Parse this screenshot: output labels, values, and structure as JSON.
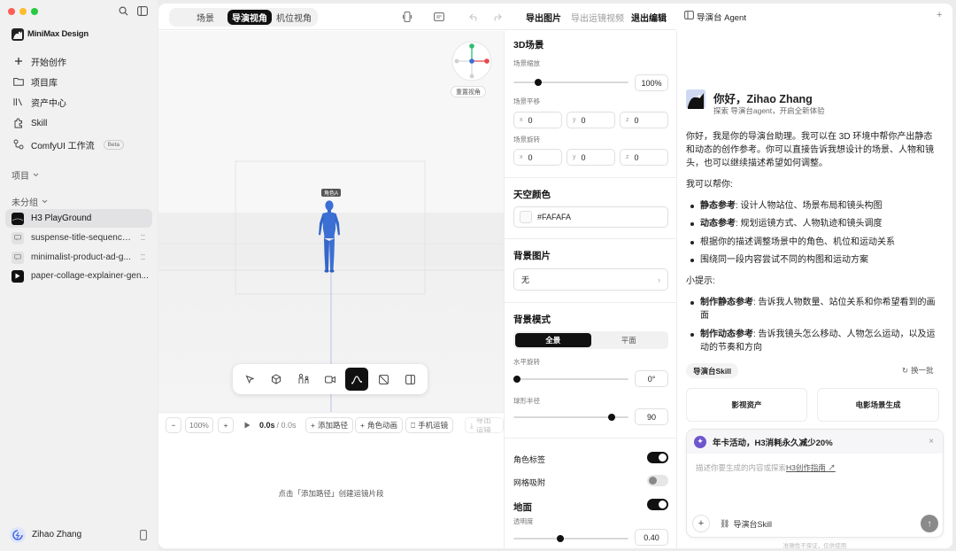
{
  "sidebar": {
    "brand": "MiniMax Design",
    "nav": [
      {
        "label": "开始创作",
        "icon": "plus-icon"
      },
      {
        "label": "项目库",
        "icon": "folder-icon"
      },
      {
        "label": "资产中心",
        "icon": "library-icon"
      },
      {
        "label": "Skill",
        "icon": "skill-icon"
      },
      {
        "label": "ComfyUI 工作流",
        "icon": "workflow-icon",
        "badge": "Beta"
      }
    ],
    "section_projects": "项目",
    "section_ungrouped": "未分组",
    "projects": [
      {
        "label": "H3 PlayGround",
        "icon": "playground-thumb-icon",
        "active": true
      },
      {
        "label": "suspense-title-sequence...",
        "icon": "chat-bubble-icon"
      },
      {
        "label": "minimalist-product-ad-g...",
        "icon": "chat-bubble-icon"
      },
      {
        "label": "paper-collage-explainer-gen...",
        "icon": "video-play-icon"
      }
    ],
    "user": "Zihao Zhang"
  },
  "toolbar": {
    "tabs": [
      "场景",
      "导演视角",
      "机位视角"
    ],
    "active_tab": "导演视角",
    "export_image": "导出图片",
    "export_video": "导出运镜视频",
    "exit_edit": "退出编辑"
  },
  "viewport": {
    "reset_view": "重置视角",
    "character_label": "角色A",
    "tools": [
      "select-tool-icon",
      "cube-tool-icon",
      "character-tool-icon",
      "camera-tool-icon",
      "path-tool-icon",
      "frame-tool-icon",
      "panel-tool-icon"
    ]
  },
  "timeline": {
    "zoom": "100%",
    "minus": "−",
    "plus": "+",
    "time_current": "0.0s",
    "time_total": "/ 0.0s",
    "add_path": "添加路径",
    "character_anim": "角色动画",
    "handheld": "手机运镜",
    "export_short": "导出运镜",
    "empty_hint": "点击「添加路径」创建运镜片段"
  },
  "properties": {
    "scene_title": "3D场景",
    "scene_scale_label": "场景缩放",
    "scene_scale_value": "100%",
    "scene_scale_fraction": 0.2,
    "scene_move_label": "场景平移",
    "scene_move": {
      "x": "0",
      "y": "0",
      "z": "0"
    },
    "scene_rotate_label": "场景旋转",
    "scene_rotate": {
      "x": "0",
      "y": "0",
      "z": "0"
    },
    "sky_title": "天空颜色",
    "sky_color": "#FAFAFA",
    "bg_image_title": "背景图片",
    "bg_image_value": "无",
    "bg_mode_title": "背景模式",
    "bg_mode_options": [
      "全景",
      "平面"
    ],
    "bg_mode_active": "全景",
    "h_rotate_label": "水平旋转",
    "h_rotate_value": "0°",
    "h_rotate_fraction": 0.0,
    "sphere_radius_label": "球形半径",
    "sphere_radius_value": "90",
    "sphere_radius_fraction": 0.88,
    "char_label_toggle": "角色标签",
    "char_label_on": true,
    "grid_snap_toggle": "网格吸附",
    "grid_snap_on": false,
    "ground_toggle": "地面",
    "ground_on": true,
    "opacity_label": "透明度",
    "opacity_value": "0.40",
    "opacity_fraction": 0.4
  },
  "agent": {
    "header": "导演台 Agent",
    "greeting": "你好，Zihao Zhang",
    "greeting_sub": "探索 导演台agent，开启全新体验",
    "intro": "你好，我是你的导演台助理。我可以在 3D 环境中帮你产出静态和动态的创作参考。你可以直接告诉我想设计的场景、人物和镜头，也可以继续描述希望如何调整。",
    "can_help": "我可以帮你:",
    "help_items": [
      {
        "bold": "静态参考",
        "text": ": 设计人物站位、场景布局和镜头构图"
      },
      {
        "bold": "动态参考",
        "text": ": 规划运镜方式、人物轨迹和镜头调度"
      },
      {
        "bold": "",
        "text": "根据你的描述调整场景中的角色、机位和运动关系"
      },
      {
        "bold": "",
        "text": "围绕同一段内容尝试不同的构图和运动方案"
      }
    ],
    "tips_title": "小提示:",
    "tips": [
      {
        "bold": "制作静态参考",
        "text": ": 告诉我人物数量、站位关系和你希望看到的画面"
      },
      {
        "bold": "制作动态参考",
        "text": ": 告诉我镜头怎么移动、人物怎么运动，以及运动的节奏和方向"
      }
    ],
    "skill_chip": "导演台Skill",
    "refresh": "换一批",
    "cards": [
      "影视资产",
      "电影场景生成"
    ],
    "promo": "年卡活动，H3消耗永久减少20%",
    "input_placeholder": "描述你要生成的内容或探索",
    "input_link": "H3创作指南 ↗",
    "input_skill": "导演台Skill",
    "footer_note": "准确性不保证，仅供使用"
  },
  "colors": {
    "accent_dark": "#111111",
    "character_blue": "#3b6fd4",
    "axis_green": "#2fbf71",
    "axis_red": "#e5484d",
    "axis_blue": "#3b6fd4",
    "promo_purple": "#6e56cf"
  }
}
